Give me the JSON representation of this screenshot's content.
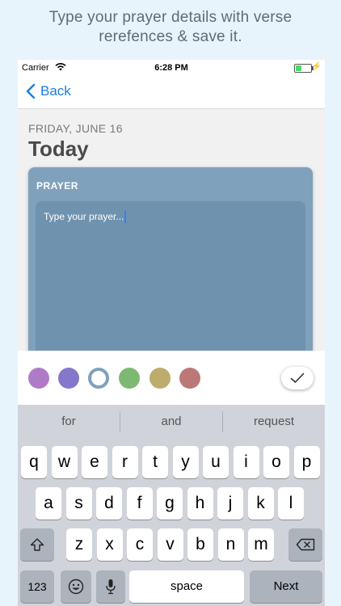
{
  "promo": {
    "line1": "Type your prayer details with verse",
    "line2": "rerefences & save it."
  },
  "status_bar": {
    "carrier": "Carrier",
    "time": "6:28 PM"
  },
  "nav": {
    "back_label": "Back"
  },
  "header": {
    "date": "FRIDAY, JUNE 16",
    "title": "Today"
  },
  "card": {
    "label": "PRAYER",
    "placeholder": "Type your prayer..."
  },
  "colors": {
    "swatches": [
      {
        "name": "purple",
        "hex": "#b07bc6"
      },
      {
        "name": "violet",
        "hex": "#8577c9"
      },
      {
        "name": "blue-gray",
        "hex": "#7fa1bb",
        "selected": true
      },
      {
        "name": "green",
        "hex": "#7db971"
      },
      {
        "name": "olive",
        "hex": "#beac6c"
      },
      {
        "name": "rose",
        "hex": "#bb7876"
      }
    ],
    "accent": "#1a7ee6"
  },
  "keyboard": {
    "suggestions": [
      "for",
      "and",
      "request"
    ],
    "row1": [
      "q",
      "w",
      "e",
      "r",
      "t",
      "y",
      "u",
      "i",
      "o",
      "p"
    ],
    "row2": [
      "a",
      "s",
      "d",
      "f",
      "g",
      "h",
      "j",
      "k",
      "l"
    ],
    "row3": [
      "z",
      "x",
      "c",
      "v",
      "b",
      "n",
      "m"
    ],
    "numbers_label": "123",
    "space_label": "space",
    "next_label": "Next",
    "shift_icon": "shift-icon",
    "delete_icon": "delete-icon",
    "emoji_icon": "emoji-icon",
    "mic_icon": "microphone-icon"
  }
}
